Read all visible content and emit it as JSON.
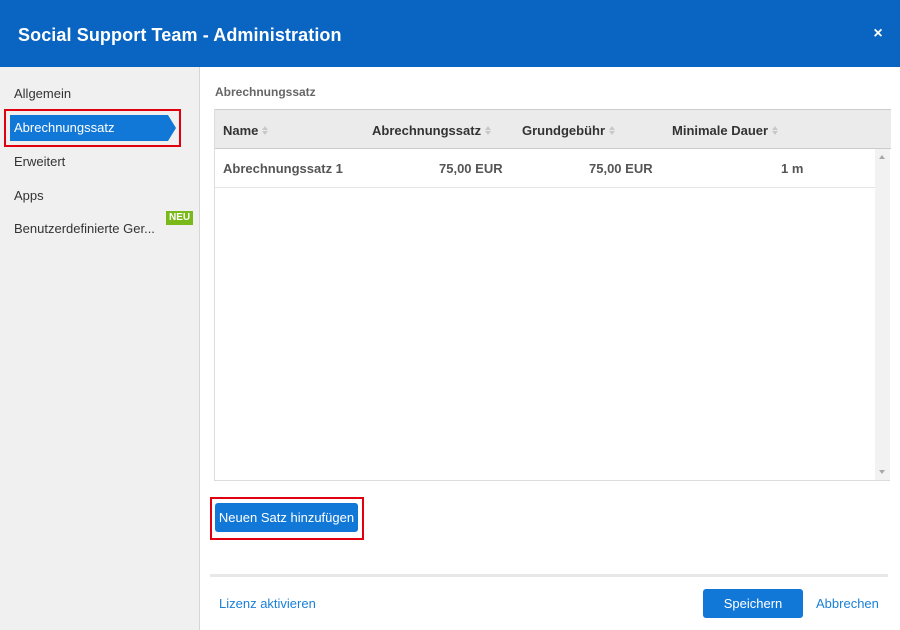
{
  "window": {
    "title": "Social Support Team - Administration",
    "close_icon": "×"
  },
  "sidebar": {
    "items": [
      {
        "label": "Allgemein"
      },
      {
        "label": "Abrechnungssatz",
        "active": true
      },
      {
        "label": "Erweitert"
      },
      {
        "label": "Apps"
      },
      {
        "label": "Benutzerdefinierte Ger...",
        "badge": "NEU"
      }
    ]
  },
  "main": {
    "section_title": "Abrechnungssatz",
    "table": {
      "columns": [
        "Name",
        "Abrechnungssatz",
        "Grundgebühr",
        "Minimale Dauer"
      ],
      "rows": [
        [
          "Abrechnungssatz 1",
          "75,00 EUR",
          "75,00 EUR",
          "1 m"
        ]
      ]
    },
    "add_button": "Neuen Satz hinzufügen"
  },
  "footer": {
    "activate_license": "Lizenz aktivieren",
    "save": "Speichern",
    "cancel": "Abbrechen"
  },
  "colors": {
    "header_bg": "#0a64c2",
    "accent": "#1278d8",
    "badge": "#79b91a",
    "highlight_box": "#e0000f",
    "link": "#1a7fd6"
  }
}
